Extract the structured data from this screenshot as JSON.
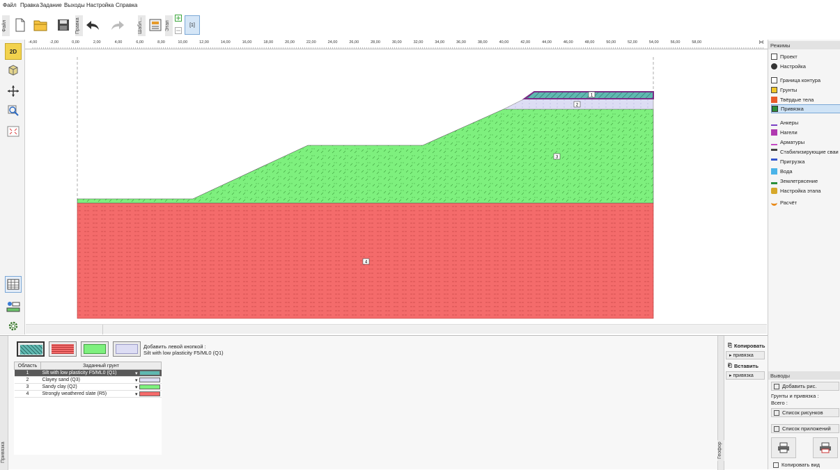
{
  "menu": [
    "Файл",
    "Правка",
    "Задание",
    "Выходы",
    "Настройка",
    "Справка"
  ],
  "toolbar": {
    "vtab_file": "Файл",
    "vtab_edit": "Правка",
    "vtab_template": "Шабл...",
    "vtab_stage": "Этап",
    "stage_label": "[1]"
  },
  "ruler": {
    "labels": [
      "-4,00",
      "-2,00",
      "0,00",
      "2,00",
      "4,00",
      "6,00",
      "8,00",
      "10,00",
      "12,00",
      "14,00",
      "16,00",
      "18,00",
      "20,00",
      "22,00",
      "24,00",
      "26,00",
      "28,00",
      "30,00",
      "32,00",
      "34,00",
      "36,00",
      "38,00",
      "40,00",
      "42,00",
      "44,00",
      "46,00",
      "48,00",
      "50,00",
      "52,00",
      "54,00",
      "56,00",
      "58,00"
    ],
    "unit": "[м]"
  },
  "left_tools": {
    "btn_2d": "2D",
    "btn_3d": "3D"
  },
  "canvas": {
    "regions": [
      {
        "id": "1",
        "color": "#5fb8b0"
      },
      {
        "id": "2",
        "color": "#ddddf4"
      },
      {
        "id": "3",
        "color": "#7ef07e"
      },
      {
        "id": "4",
        "color": "#f46b6b"
      }
    ]
  },
  "right_panel": {
    "modes_title": "Режимы",
    "modes": [
      "Проект",
      "Настройка",
      "Граница контура",
      "Грунты",
      "Твёрдые тела",
      "Привязка",
      "Анкеры",
      "Нагели",
      "Арматуры",
      "Стабилизирующие сваи",
      "Пригрузка",
      "Вода",
      "Землетрясение",
      "Настройка этапа",
      "Расчёт"
    ],
    "active_mode": "Привязка",
    "outputs_title": "Выводы",
    "add_picture": "Добавить рис.",
    "soils_and_assign": "Грунты и привязка :",
    "total": "Всего :",
    "list_pictures": "Список рисунков",
    "list_appendix": "Список приложений",
    "copy_view": "Копировать вид"
  },
  "bottom_panel": {
    "hint_title": "Добавить левой кнопкой :",
    "hint_value": "Silt with low plasticity F5/ML0 (Q1)",
    "table_headers": [
      "Область",
      "Заданный грунт"
    ],
    "rows": [
      {
        "n": "1",
        "soil": "Silt with low plasticity F5/ML0 (Q1)",
        "color": "#5fb8b0"
      },
      {
        "n": "2",
        "soil": "Clayey sand (Q3)",
        "color": "#ddddf4"
      },
      {
        "n": "3",
        "soil": "Sandy clay (Q2)",
        "color": "#7ef07e"
      },
      {
        "n": "4",
        "soil": "Strongly weathered slate (R5)",
        "color": "#f46b6b"
      }
    ],
    "copy_label": "Копировать",
    "assign_label": "привязка",
    "paste_label": "Вставить",
    "assign_label2": "привязка",
    "side_tab": "Привязка",
    "geofor_tab": "Геофор"
  }
}
